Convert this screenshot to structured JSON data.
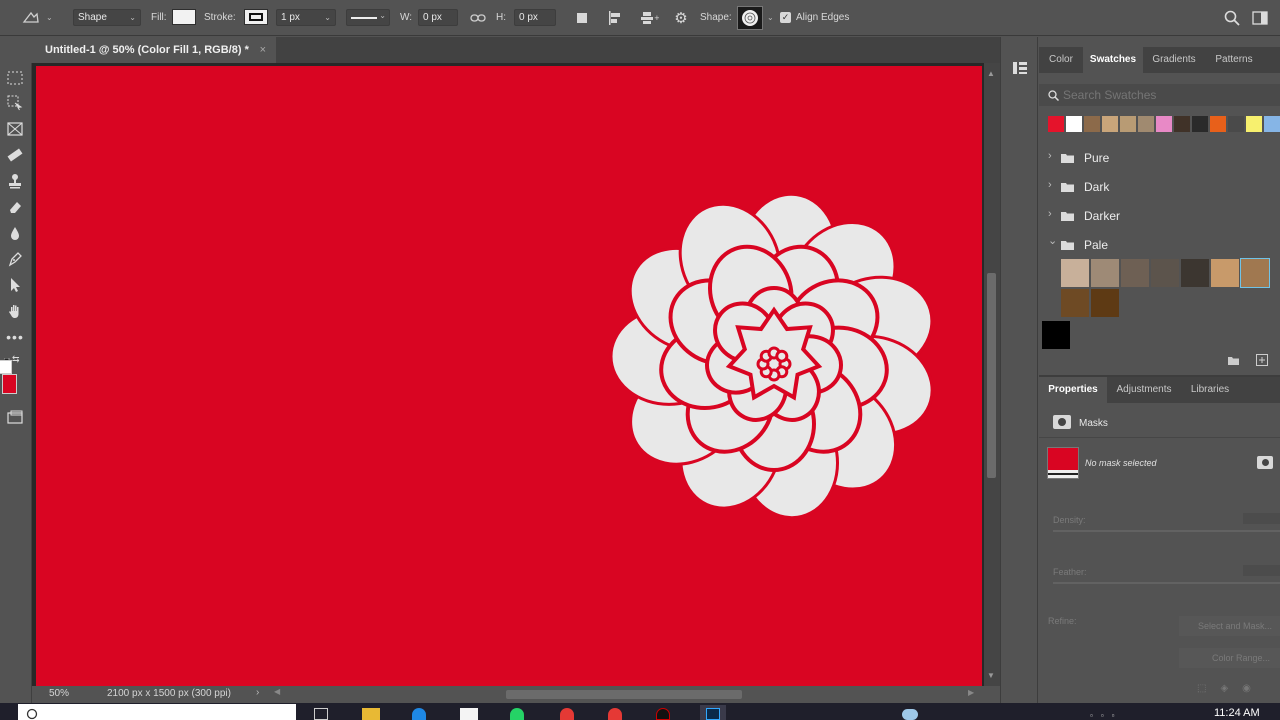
{
  "options_bar": {
    "tool_mode": "Shape",
    "fill_label": "Fill:",
    "fill_color": "#f2f2f2",
    "stroke_label": "Stroke:",
    "stroke_width": "1 px",
    "w_label": "W:",
    "w_value": "0 px",
    "h_label": "H:",
    "h_value": "0 px",
    "shape_label": "Shape:",
    "align_edges_label": "Align Edges"
  },
  "document": {
    "tab_title": "Untitled-1 @ 50% (Color Fill 1, RGB/8) *",
    "close_glyph": "×",
    "canvas_color": "#d90522",
    "flower_color": "#e8e8e8"
  },
  "status_bar": {
    "zoom": "50%",
    "doc_info": "2100 px x 1500 px (300 ppi)"
  },
  "colors": {
    "foreground": "#d90522",
    "background": "#ffffff"
  },
  "swatches_panel": {
    "tabs": [
      "Color",
      "Swatches",
      "Gradients",
      "Patterns"
    ],
    "active_tab": "Swatches",
    "search_placeholder": "Search Swatches",
    "recent_swatches": [
      "#e5132b",
      "#ffffff",
      "#8c6a4a",
      "#c9a57a",
      "#b89b74",
      "#a08a70",
      "#e889c6",
      "#403228",
      "#2a2a2a",
      "#e8601a",
      "#4a4a4a",
      "#f7f06e",
      "#86b5e6",
      "#7a5230"
    ],
    "folders": [
      {
        "name": "Pure",
        "expanded": false
      },
      {
        "name": "Dark",
        "expanded": false
      },
      {
        "name": "Darker",
        "expanded": false
      },
      {
        "name": "Pale",
        "expanded": true
      }
    ],
    "pale_swatches": [
      "#c8b09a",
      "#9e8a76",
      "#6e6054",
      "#5c544c",
      "#3c3630",
      "#c89a6a",
      "#a07850",
      "#6e4a24",
      "#5e3a14"
    ],
    "extra_swatches": [
      "#000000"
    ]
  },
  "properties_panel": {
    "tabs": [
      "Properties",
      "Adjustments",
      "Libraries"
    ],
    "active_tab": "Properties",
    "section_title": "Masks",
    "mask_status": "No mask selected",
    "density_label": "Density:",
    "feather_label": "Feather:",
    "refine_label": "Refine:",
    "select_and_mask_label": "Select and Mask...",
    "color_range_label": "Color Range..."
  },
  "taskbar": {
    "time": "11:24 AM"
  }
}
